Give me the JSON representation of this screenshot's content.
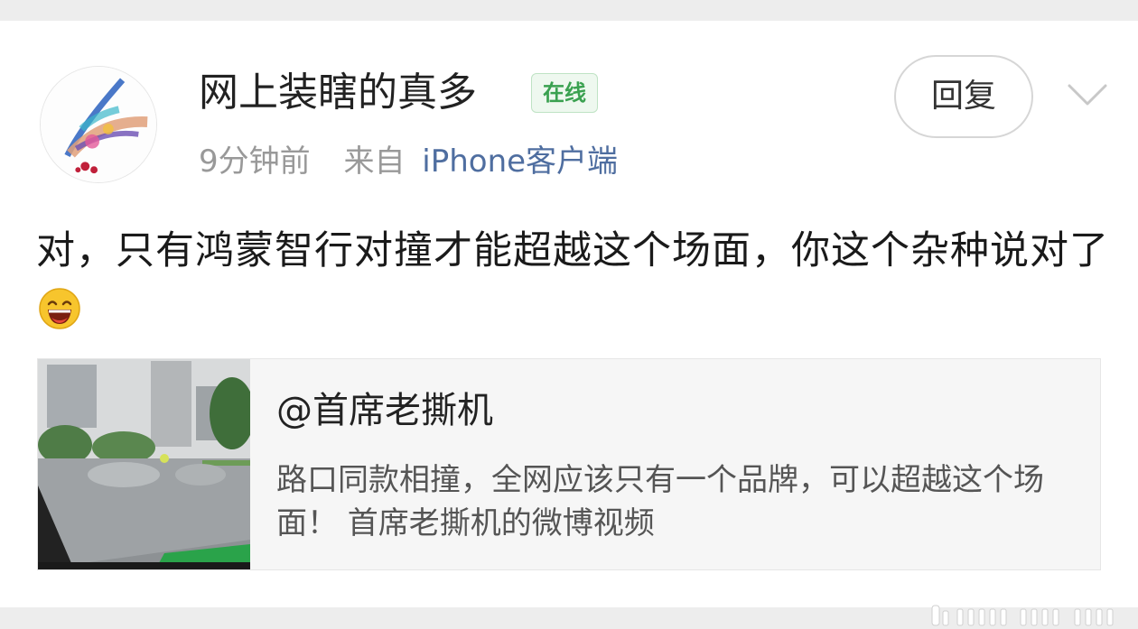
{
  "user": {
    "name": "网上装瞎的真多",
    "status_badge": "在线",
    "time": "9分钟前",
    "source_label": "来自",
    "source_client": "iPhone客户端"
  },
  "actions": {
    "reply_label": "回复"
  },
  "comment": {
    "text": "对，只有鸿蒙智行对撞才能超越这个场面，你这个杂种说对了",
    "emoji": "laughing-emoji"
  },
  "repost": {
    "author": "@首席老撕机",
    "text": "路口同款相撞，全网应该只有一个品牌，可以超越这个场面！ 首席老撕机的微博视频"
  },
  "colors": {
    "accent_link": "#4f6ea0",
    "badge_green": "#3aa150",
    "background": "#ededed"
  }
}
